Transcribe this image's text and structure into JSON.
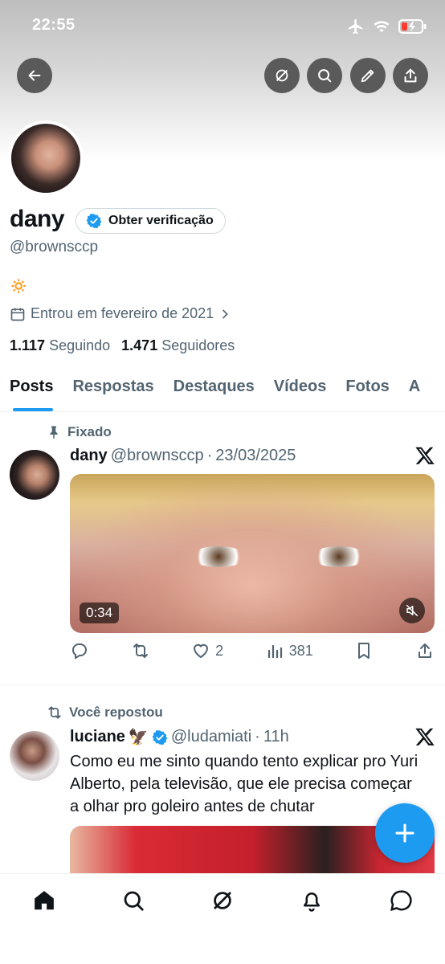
{
  "status_bar": {
    "time": "22:55"
  },
  "profile": {
    "name": "dany",
    "verify_label": "Obter verificação",
    "handle": "@brownsccp",
    "bio": "🔅",
    "joined": "Entrou em fevereiro de 2021",
    "following_count": "1.117",
    "following_label": "Seguindo",
    "followers_count": "1.471",
    "followers_label": "Seguidores"
  },
  "tabs": [
    {
      "label": "Posts",
      "active": true
    },
    {
      "label": "Respostas"
    },
    {
      "label": "Destaques"
    },
    {
      "label": "Vídeos"
    },
    {
      "label": "Fotos"
    },
    {
      "label": "A"
    }
  ],
  "posts": [
    {
      "context": "Fixado",
      "author": "dany",
      "handle": "@brownsccp",
      "sep": "·",
      "date": "23/03/2025",
      "media_duration": "0:34",
      "likes": "2",
      "views": "381"
    },
    {
      "context": "Você repostou",
      "author": "luciane",
      "emoji": "🦅",
      "handle": "@ludamiati",
      "sep": "·",
      "date": "11h",
      "text": "Como eu me sinto quando tento explicar pro Yuri Alberto, pela televisão, que ele precisa começar a olhar pro goleiro antes de chutar"
    }
  ],
  "colors": {
    "accent": "#1d9bf0",
    "secondary_text": "#536471",
    "primary_text": "#0f1419"
  },
  "icons": [
    "back-arrow-icon",
    "grok-icon",
    "search-icon",
    "edit-icon",
    "share-icon",
    "verified-badge-icon",
    "calendar-icon",
    "pin-icon",
    "x-logo-icon",
    "reply-icon",
    "repost-icon",
    "like-icon",
    "views-icon",
    "bookmark-icon",
    "mute-icon",
    "plus-icon",
    "home-icon",
    "notifications-icon",
    "messages-icon"
  ]
}
